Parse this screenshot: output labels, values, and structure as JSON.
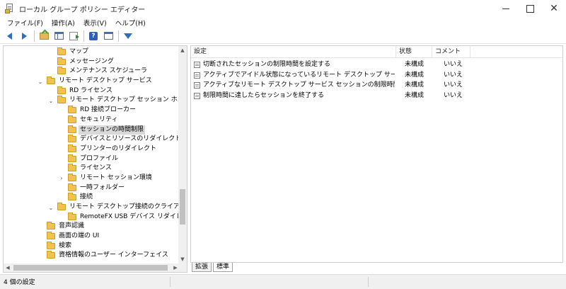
{
  "window": {
    "title": "ローカル グループ ポリシー エディター",
    "close_glyph": "✕"
  },
  "menu": [
    "ファイル(F)",
    "操作(A)",
    "表示(V)",
    "ヘルプ(H)"
  ],
  "toolbar": {
    "buttons": [
      "back-icon",
      "forward-icon",
      "up-folder-icon",
      "show-hide-tree-icon",
      "export-list-icon",
      "help-icon",
      "properties-icon",
      "filter-icon"
    ],
    "help_glyph": "?"
  },
  "tree": {
    "items": [
      {
        "label": "マップ",
        "expander": ""
      },
      {
        "label": "メッセージング",
        "expander": ""
      },
      {
        "label": "メンテナンス スケジューラ",
        "expander": ""
      },
      {
        "label": "リモート デスクトップ サービス",
        "expander": "⌄"
      },
      {
        "label": "RD ライセンス",
        "expander": ""
      },
      {
        "label": "リモート デスクトップ セッション ホスト",
        "expander": "⌄"
      },
      {
        "label": "RD 接続ブローカー",
        "expander": ""
      },
      {
        "label": "セキュリティ",
        "expander": ""
      },
      {
        "label": "セッションの時間制限",
        "expander": "",
        "selected": true
      },
      {
        "label": "デバイスとリソースのリダイレクト",
        "expander": ""
      },
      {
        "label": "プリンターのリダイレクト",
        "expander": ""
      },
      {
        "label": "プロファイル",
        "expander": ""
      },
      {
        "label": "ライセンス",
        "expander": ""
      },
      {
        "label": "リモート セッション環境",
        "expander": "›"
      },
      {
        "label": "一時フォルダー",
        "expander": ""
      },
      {
        "label": "接続",
        "expander": ""
      },
      {
        "label": "リモート デスクトップ接続のクライアント",
        "expander": "⌄"
      },
      {
        "label": "RemoteFX USB デバイス リダイレクト",
        "expander": ""
      },
      {
        "label": "音声認識",
        "expander": ""
      },
      {
        "label": "画面の端の UI",
        "expander": ""
      },
      {
        "label": "検索",
        "expander": ""
      },
      {
        "label": "資格情報のユーザー インターフェイス",
        "expander": ""
      }
    ],
    "scroll_up": "▲",
    "scroll_down": "▼",
    "scroll_left": "◀",
    "scroll_right": "▶"
  },
  "list": {
    "columns": [
      "設定",
      "状態",
      "コメント"
    ],
    "rows": [
      {
        "setting": "切断されたセッションの制限時間を設定する",
        "state": "未構成",
        "comment": "いいえ"
      },
      {
        "setting": "アクティブでアイドル状態になっているリモート デスクトップ サービス セッション...",
        "state": "未構成",
        "comment": "いいえ"
      },
      {
        "setting": "アクティブなリモート デスクトップ サービス セッションの制限時間を設定する",
        "state": "未構成",
        "comment": "いいえ"
      },
      {
        "setting": "制限時間に達したらセッションを終了する",
        "state": "未構成",
        "comment": "いいえ"
      }
    ]
  },
  "tabs": [
    {
      "label": "拡張",
      "active": false
    },
    {
      "label": "標準",
      "active": true
    }
  ],
  "status": {
    "text": "4 個の設定"
  }
}
